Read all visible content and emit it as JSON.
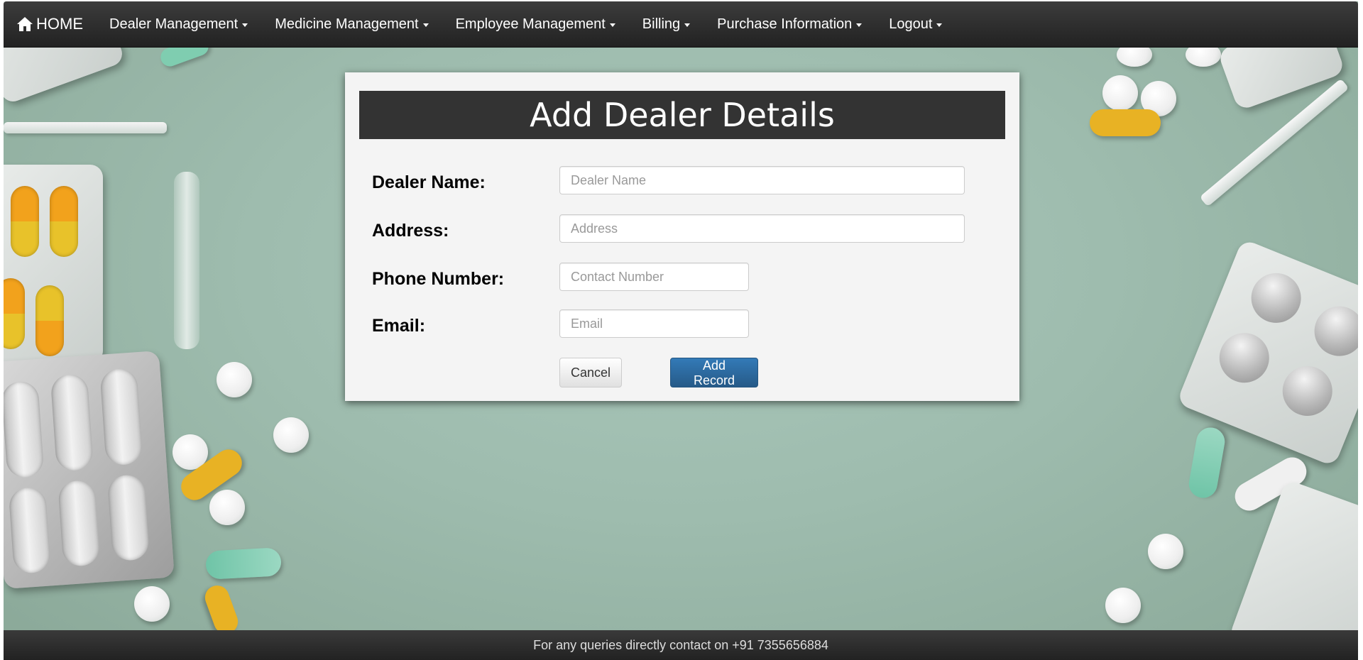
{
  "navbar": {
    "brand": "HOME",
    "items": [
      {
        "label": "Dealer Management"
      },
      {
        "label": "Medicine Management"
      },
      {
        "label": "Employee Management"
      },
      {
        "label": "Billing"
      },
      {
        "label": "Purchase Information"
      },
      {
        "label": "Logout"
      }
    ]
  },
  "form": {
    "title": "Add Dealer Details",
    "fields": [
      {
        "label": "Dealer Name:",
        "placeholder": "Dealer Name",
        "value": ""
      },
      {
        "label": "Address:",
        "placeholder": "Address",
        "value": ""
      },
      {
        "label": "Phone Number:",
        "placeholder": "Contact Number",
        "value": ""
      },
      {
        "label": "Email:",
        "placeholder": "Email",
        "value": ""
      }
    ],
    "cancel_label": "Cancel",
    "submit_label": "Add Record"
  },
  "footer": {
    "text": "For any queries directly contact on +91 7355656884"
  },
  "colors": {
    "navbar": "#222222",
    "primary_button": "#337ab7",
    "card_background": "#f4f4f4",
    "header_background": "#333333"
  }
}
